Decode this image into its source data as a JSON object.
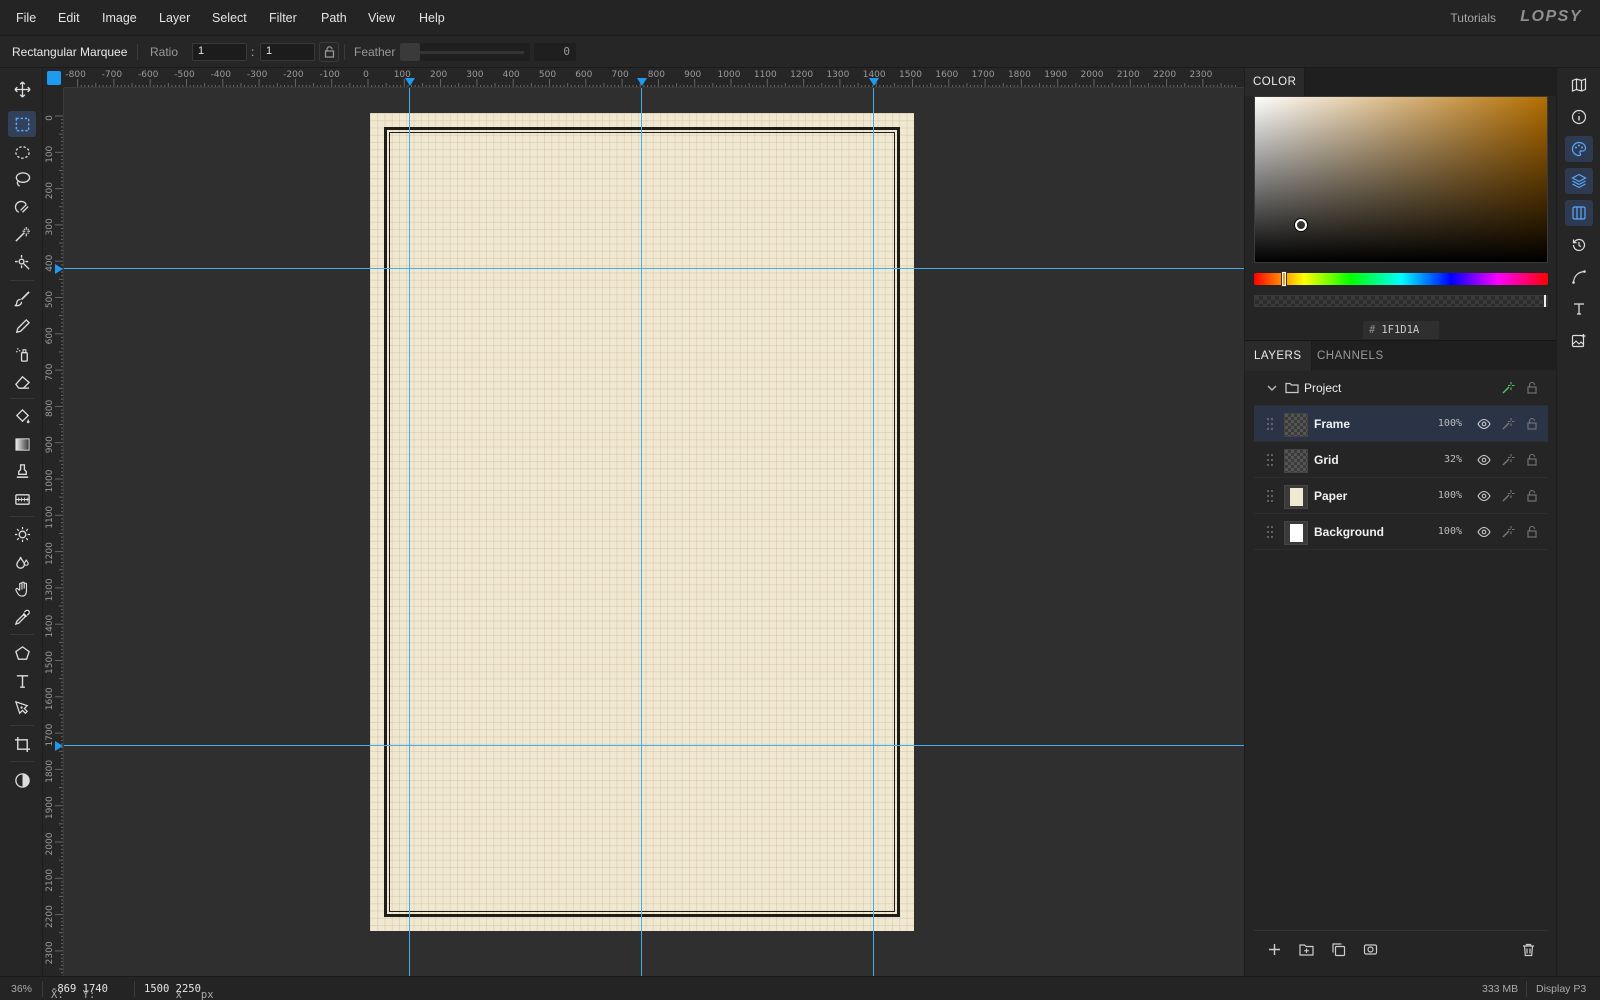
{
  "app": {
    "logo": "LOPSY",
    "tutorials_label": "Tutorials"
  },
  "menu": {
    "items": [
      "File",
      "Edit",
      "Image",
      "Layer",
      "Select",
      "Filter",
      "Path",
      "View",
      "Help"
    ]
  },
  "options": {
    "tool_name": "Rectangular Marquee",
    "ratio_label": "Ratio",
    "ratio_w": "1",
    "ratio_sep": ":",
    "ratio_h": "1",
    "feather_label": "Feather",
    "feather_value": "0"
  },
  "toolbar": {
    "tools": [
      "move-tool",
      "rectangular-marquee-tool",
      "elliptical-marquee-tool",
      "lasso-tool",
      "magnetic-lasso-tool",
      "magic-wand-tool",
      "quick-selection-tool",
      "paint-brush-tool",
      "pencil-tool",
      "spray-tool",
      "eraser-tool",
      "paint-bucket-tool",
      "gradient-tool",
      "clone-stamp-tool",
      "pattern-tool",
      "dodge-tool",
      "blur-tool",
      "hand-tool",
      "eyedropper-tool",
      "shape-tool",
      "text-tool",
      "pen-tool",
      "crop-tool",
      "color-mode-toggle"
    ],
    "active_tool": "rectangular-marquee-tool"
  },
  "rulers": {
    "top_labels": [
      "-800",
      "-700",
      "-600",
      "-500",
      "-400",
      "-300",
      "-200",
      "-100",
      "0",
      "100",
      "200",
      "300",
      "400",
      "500",
      "600",
      "700",
      "800",
      "900",
      "1000",
      "1100",
      "1200",
      "1300",
      "1400",
      "1500",
      "1600",
      "1700",
      "1800",
      "1900",
      "2000",
      "2100",
      "2200",
      "2300"
    ],
    "left_labels": [
      "0",
      "100",
      "200",
      "300",
      "400",
      "500",
      "600",
      "700",
      "800",
      "900",
      "1000",
      "1100",
      "1200",
      "1300",
      "1400",
      "1500",
      "1600",
      "1700",
      "1800",
      "1900",
      "2000",
      "2100",
      "2200",
      "2300"
    ]
  },
  "color_panel": {
    "title": "COLOR",
    "hex_label": "#",
    "hex_value": "1F1D1A",
    "hue_color": "#b36d00"
  },
  "layers_panel": {
    "tabs": [
      "LAYERS",
      "CHANNELS"
    ],
    "group_name": "Project",
    "layers": [
      {
        "name": "Frame",
        "opacity": "100%",
        "selected": true
      },
      {
        "name": "Grid",
        "opacity": "32%",
        "selected": false
      },
      {
        "name": "Paper",
        "opacity": "100%",
        "selected": false
      },
      {
        "name": "Background",
        "opacity": "100%",
        "selected": false
      }
    ]
  },
  "right_strip": {
    "icons": [
      "navigator-icon",
      "info-icon",
      "color-palette-icon",
      "layers-icon",
      "channels-icon",
      "history-icon",
      "curves-icon",
      "type-icon",
      "image-adjust-icon"
    ]
  },
  "status": {
    "zoom": "36%",
    "x_label": "X:",
    "x_value": "-869",
    "y_label": "Y:",
    "y_value": "1740",
    "doc_w": "1500",
    "doc_x": "x",
    "doc_h": "2250",
    "doc_unit": "px",
    "memory": "333 MB",
    "color_profile": "Display P3"
  },
  "colors": {
    "accent": "#1e9bf0",
    "guide": "#3fb1ea",
    "paper": "#f1e8d2",
    "frame": "#1f1d1a"
  }
}
